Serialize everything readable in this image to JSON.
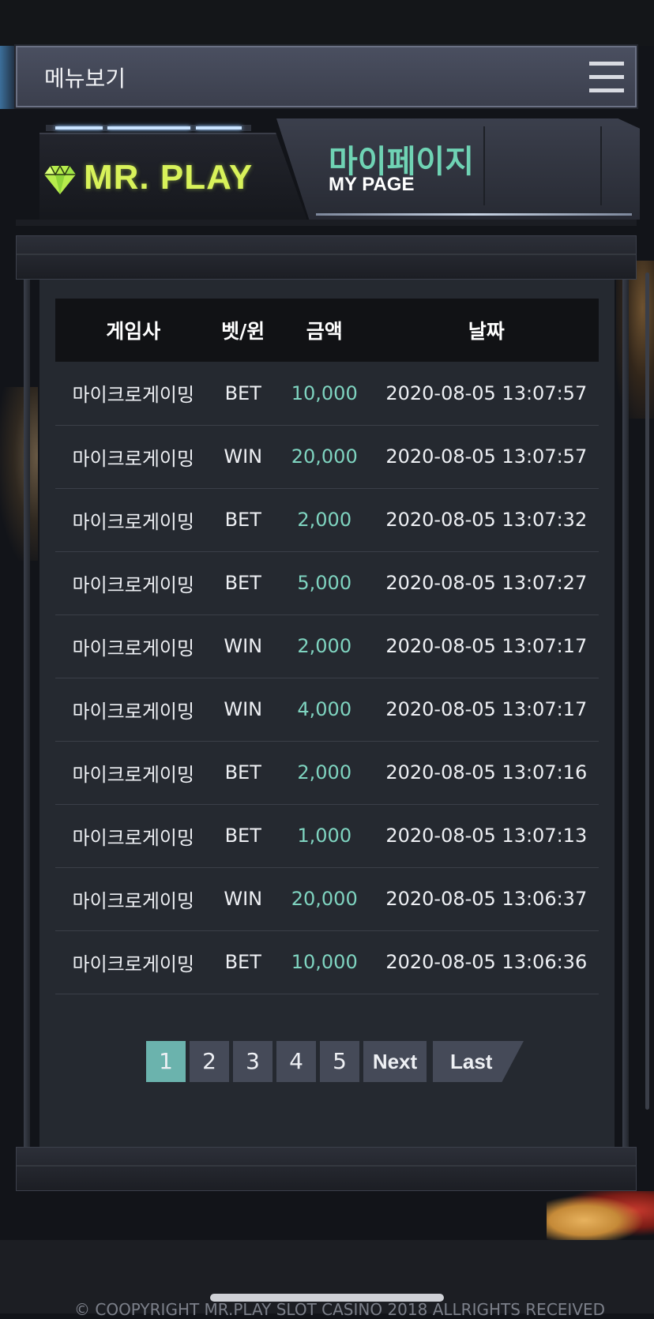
{
  "menu": {
    "label": "메뉴보기"
  },
  "brand": {
    "name": "MR. PLAY",
    "logo_color": "#d8f25a"
  },
  "page": {
    "title_kr": "마이페이지",
    "title_en": "MY PAGE",
    "accent": "#6fd3b4"
  },
  "table": {
    "headers": [
      "게임사",
      "벳/윈",
      "금액",
      "날짜"
    ],
    "rows": [
      [
        "마이크로게이밍",
        "BET",
        "10,000",
        "2020-08-05 13:07:57"
      ],
      [
        "마이크로게이밍",
        "WIN",
        "20,000",
        "2020-08-05 13:07:57"
      ],
      [
        "마이크로게이밍",
        "BET",
        "2,000",
        "2020-08-05 13:07:32"
      ],
      [
        "마이크로게이밍",
        "BET",
        "5,000",
        "2020-08-05 13:07:27"
      ],
      [
        "마이크로게이밍",
        "WIN",
        "2,000",
        "2020-08-05 13:07:17"
      ],
      [
        "마이크로게이밍",
        "WIN",
        "4,000",
        "2020-08-05 13:07:17"
      ],
      [
        "마이크로게이밍",
        "BET",
        "2,000",
        "2020-08-05 13:07:16"
      ],
      [
        "마이크로게이밍",
        "BET",
        "1,000",
        "2020-08-05 13:07:13"
      ],
      [
        "마이크로게이밍",
        "WIN",
        "20,000",
        "2020-08-05 13:06:37"
      ],
      [
        "마이크로게이밍",
        "BET",
        "10,000",
        "2020-08-05 13:06:36"
      ]
    ]
  },
  "pagination": {
    "pages": [
      "1",
      "2",
      "3",
      "4",
      "5"
    ],
    "current": "1",
    "next_label": "Next",
    "last_label": "Last",
    "active_color": "#6bb3ad"
  },
  "footer": {
    "copyright": "© COOPYRIGHT MR.PLAY SLOT CASINO 2018 ALLRIGHTS RECEIVED"
  }
}
